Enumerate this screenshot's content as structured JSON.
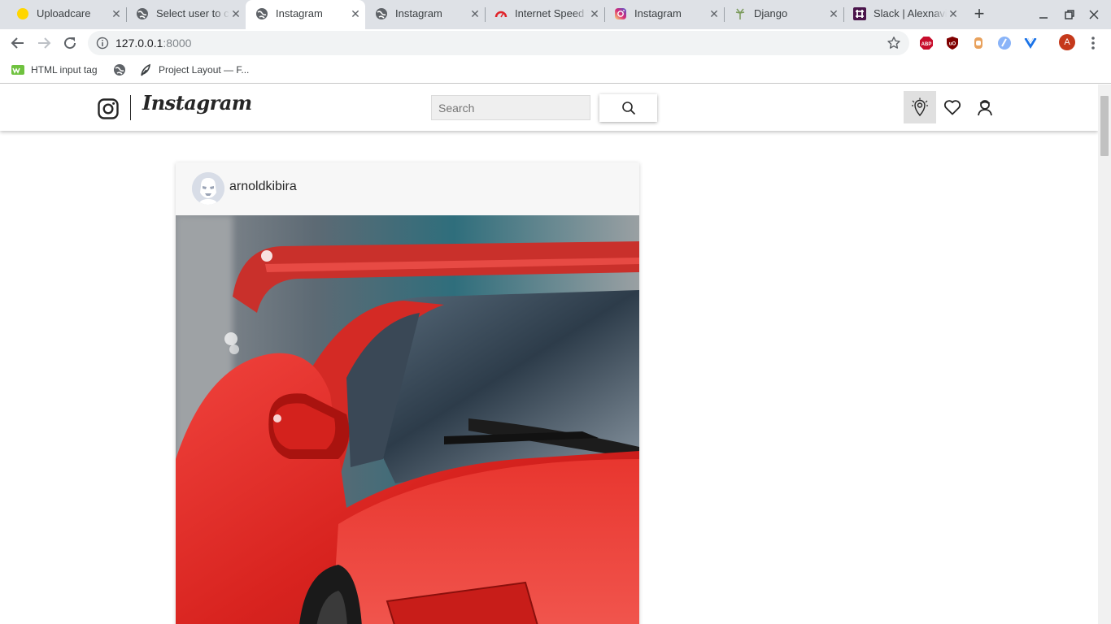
{
  "browser": {
    "tabs": [
      {
        "title": "Uploadcare",
        "icon": "uploadcare-icon"
      },
      {
        "title": "Select user to change",
        "icon": "globe-icon"
      },
      {
        "title": "Instagram",
        "icon": "globe-icon",
        "active": true
      },
      {
        "title": "Instagram",
        "icon": "globe-icon"
      },
      {
        "title": "Internet Speed Test",
        "icon": "speedtest-icon"
      },
      {
        "title": "Instagram",
        "icon": "instagram-icon"
      },
      {
        "title": "Django",
        "icon": "django-icon"
      },
      {
        "title": "Slack | Alexnavi",
        "icon": "slack-icon"
      }
    ],
    "url_host": "127.0.0.1",
    "url_port": ":8000",
    "profile_initial": "A",
    "bookmarks": [
      {
        "label": "HTML input tag",
        "icon": "w3schools-icon"
      },
      {
        "label": "",
        "icon": "globe-icon"
      },
      {
        "label": "Project Layout — F...",
        "icon": "feather-icon"
      }
    ],
    "extensions": [
      "adblock-plus-icon",
      "ublock-icon",
      "extension-icon",
      "extension-icon",
      "vue-devtools-icon"
    ],
    "accent": "#1a73e8"
  },
  "app": {
    "brand": "Instagram",
    "search": {
      "placeholder": "Search",
      "value": ""
    },
    "nav_icons": [
      "explore-icon",
      "heart-icon",
      "profile-icon"
    ]
  },
  "post": {
    "username": "arnoldkibira",
    "image_subject": "red sports car",
    "image_colors": {
      "body": "#d8231f",
      "glass": "#3a4a5a"
    }
  }
}
